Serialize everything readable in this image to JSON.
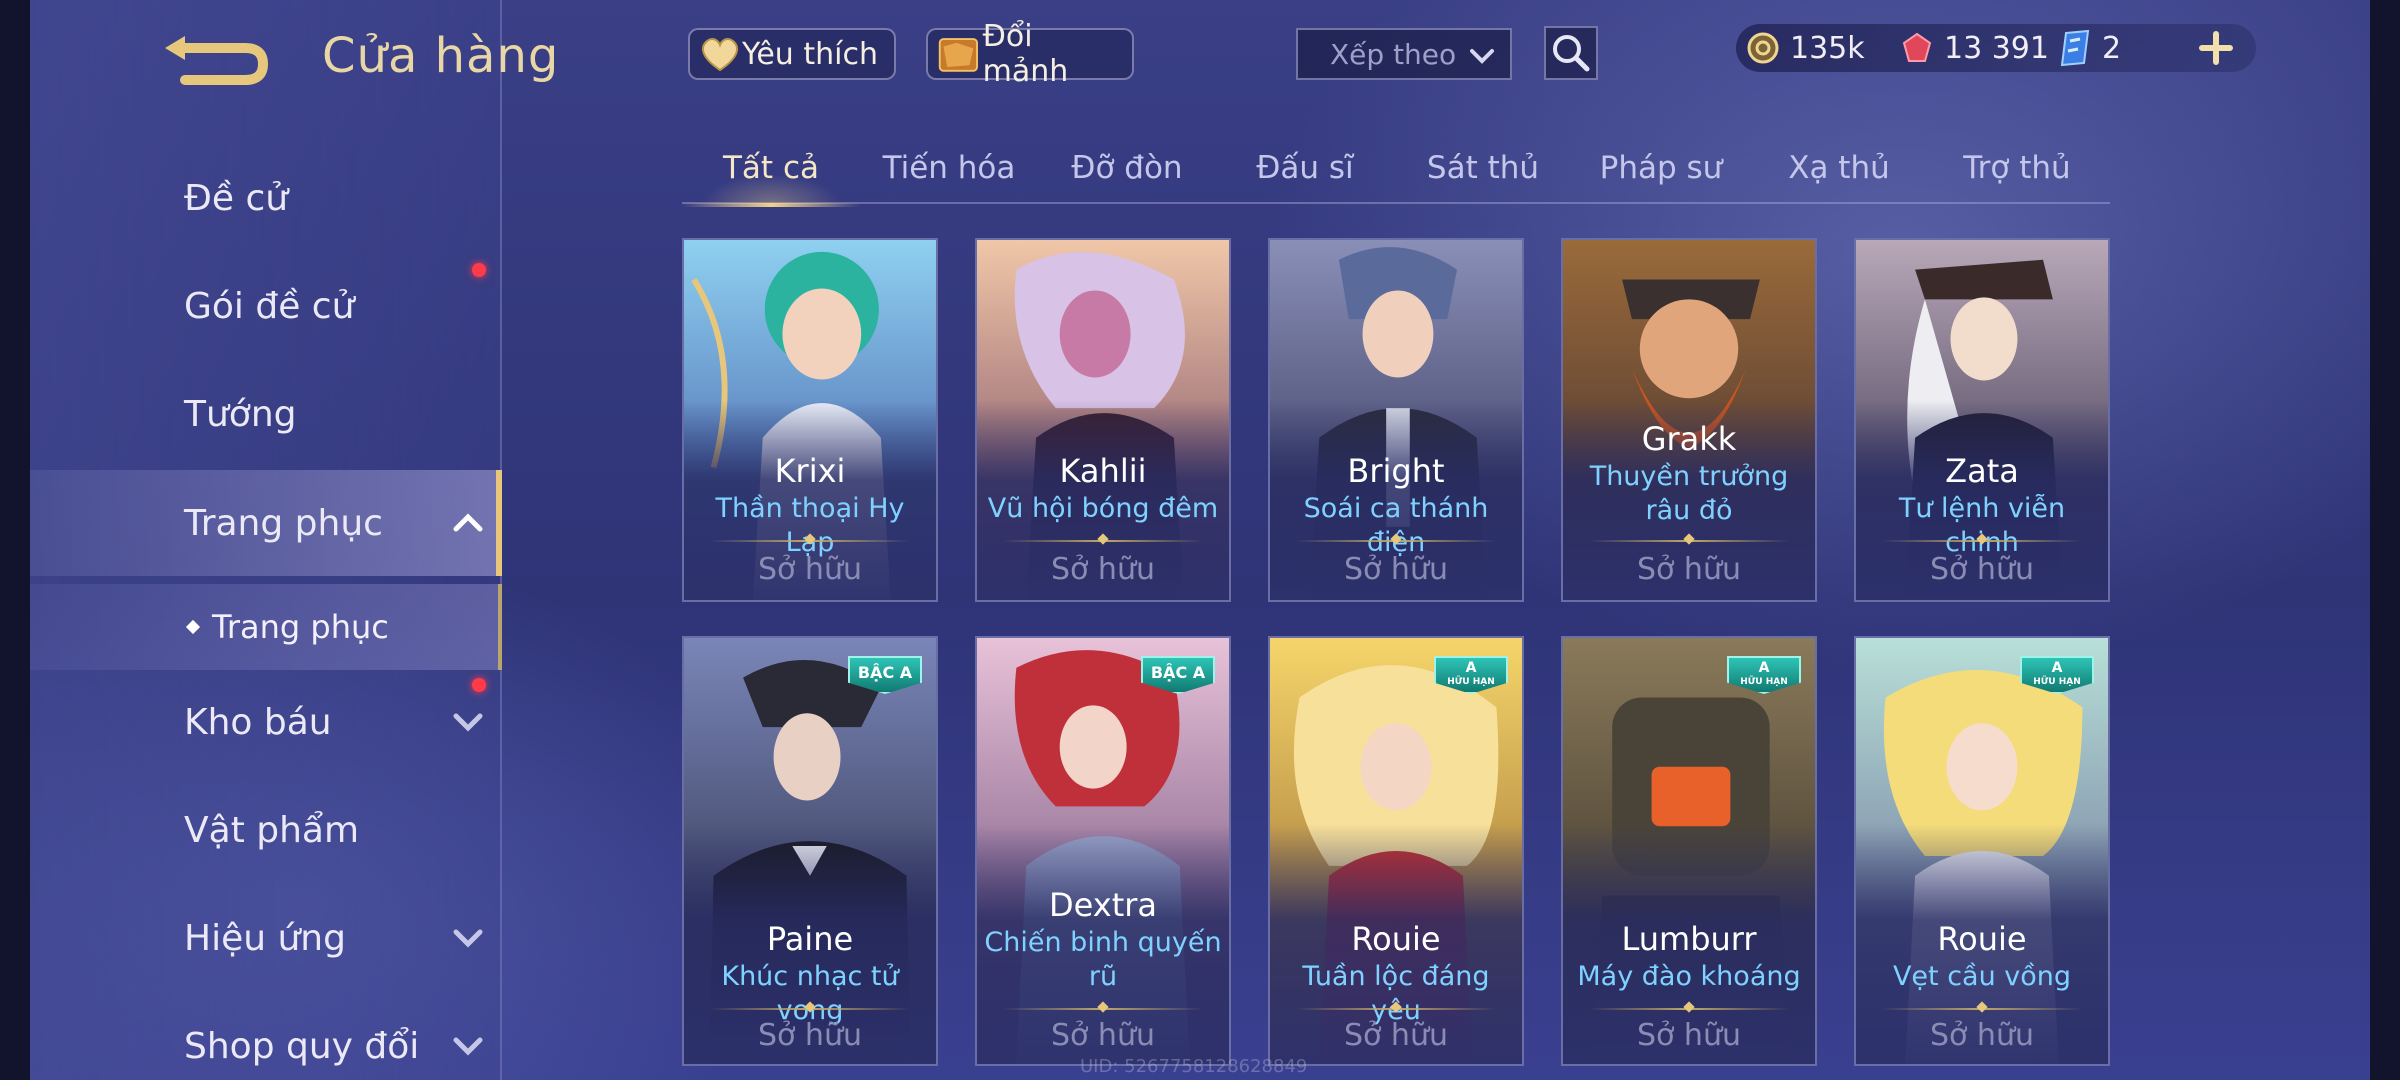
{
  "header": {
    "title": "Cửa hàng",
    "favorite_label": "Yêu thích",
    "exchange_label": "Đổi mảnh",
    "sort_placeholder": "Xếp theo"
  },
  "currency": {
    "gold": "135k",
    "ruby": "13 391",
    "vouchers": "2"
  },
  "sidebar": {
    "items": [
      {
        "label": "Đề cử"
      },
      {
        "label": "Gói đề cử"
      },
      {
        "label": "Tướng"
      },
      {
        "label": "Trang phục"
      },
      {
        "label": "Kho báu"
      },
      {
        "label": "Vật phẩm"
      },
      {
        "label": "Hiệu ứng"
      },
      {
        "label": "Shop quy đổi"
      }
    ],
    "sub_item": "Trang phục"
  },
  "tabs": [
    {
      "label": "Tất cả"
    },
    {
      "label": "Tiến hóa"
    },
    {
      "label": "Đỡ đòn"
    },
    {
      "label": "Đấu sĩ"
    },
    {
      "label": "Sát thủ"
    },
    {
      "label": "Pháp sư"
    },
    {
      "label": "Xạ thủ"
    },
    {
      "label": "Trợ thủ"
    }
  ],
  "cards": [
    {
      "hero": "Krixi",
      "skin": "Thần thoại Hy Lạp",
      "status": "Sở hữu"
    },
    {
      "hero": "Kahlii",
      "skin": "Vũ hội bóng đêm",
      "status": "Sở hữu"
    },
    {
      "hero": "Bright",
      "skin": "Soái ca thánh điện",
      "status": "Sở hữu"
    },
    {
      "hero": "Grakk",
      "skin": "Thuyền trưởng râu đỏ",
      "status": "Sở hữu"
    },
    {
      "hero": "Zata",
      "skin": "Tư lệnh viễn chinh",
      "status": "Sở hữu"
    },
    {
      "hero": "Paine",
      "skin": "Khúc nhạc tử vong",
      "status": "Sở hữu",
      "badge": "BẬC A"
    },
    {
      "hero": "Dextra",
      "skin": "Chiến binh quyến rũ",
      "status": "Sở hữu",
      "badge": "BẬC A"
    },
    {
      "hero": "Rouie",
      "skin": "Tuần lộc đáng yêu",
      "status": "Sở hữu",
      "badge": "A",
      "badge_sub": "HỮU HẠN"
    },
    {
      "hero": "Lumburr",
      "skin": "Máy đào khoáng",
      "status": "Sở hữu",
      "badge": "A",
      "badge_sub": "HỮU HẠN"
    },
    {
      "hero": "Rouie",
      "skin": "Vẹt cầu vồng",
      "status": "Sở hữu",
      "badge": "A",
      "badge_sub": "HỮU HẠN"
    }
  ],
  "footer": {
    "uid": "UID: 5267758128628849"
  },
  "colors": {
    "accent_gold": "#e6c77c",
    "skin_name": "#7fd2ff",
    "badge_teal": "#2ec4b6",
    "notification_red": "#ff3b4a"
  }
}
